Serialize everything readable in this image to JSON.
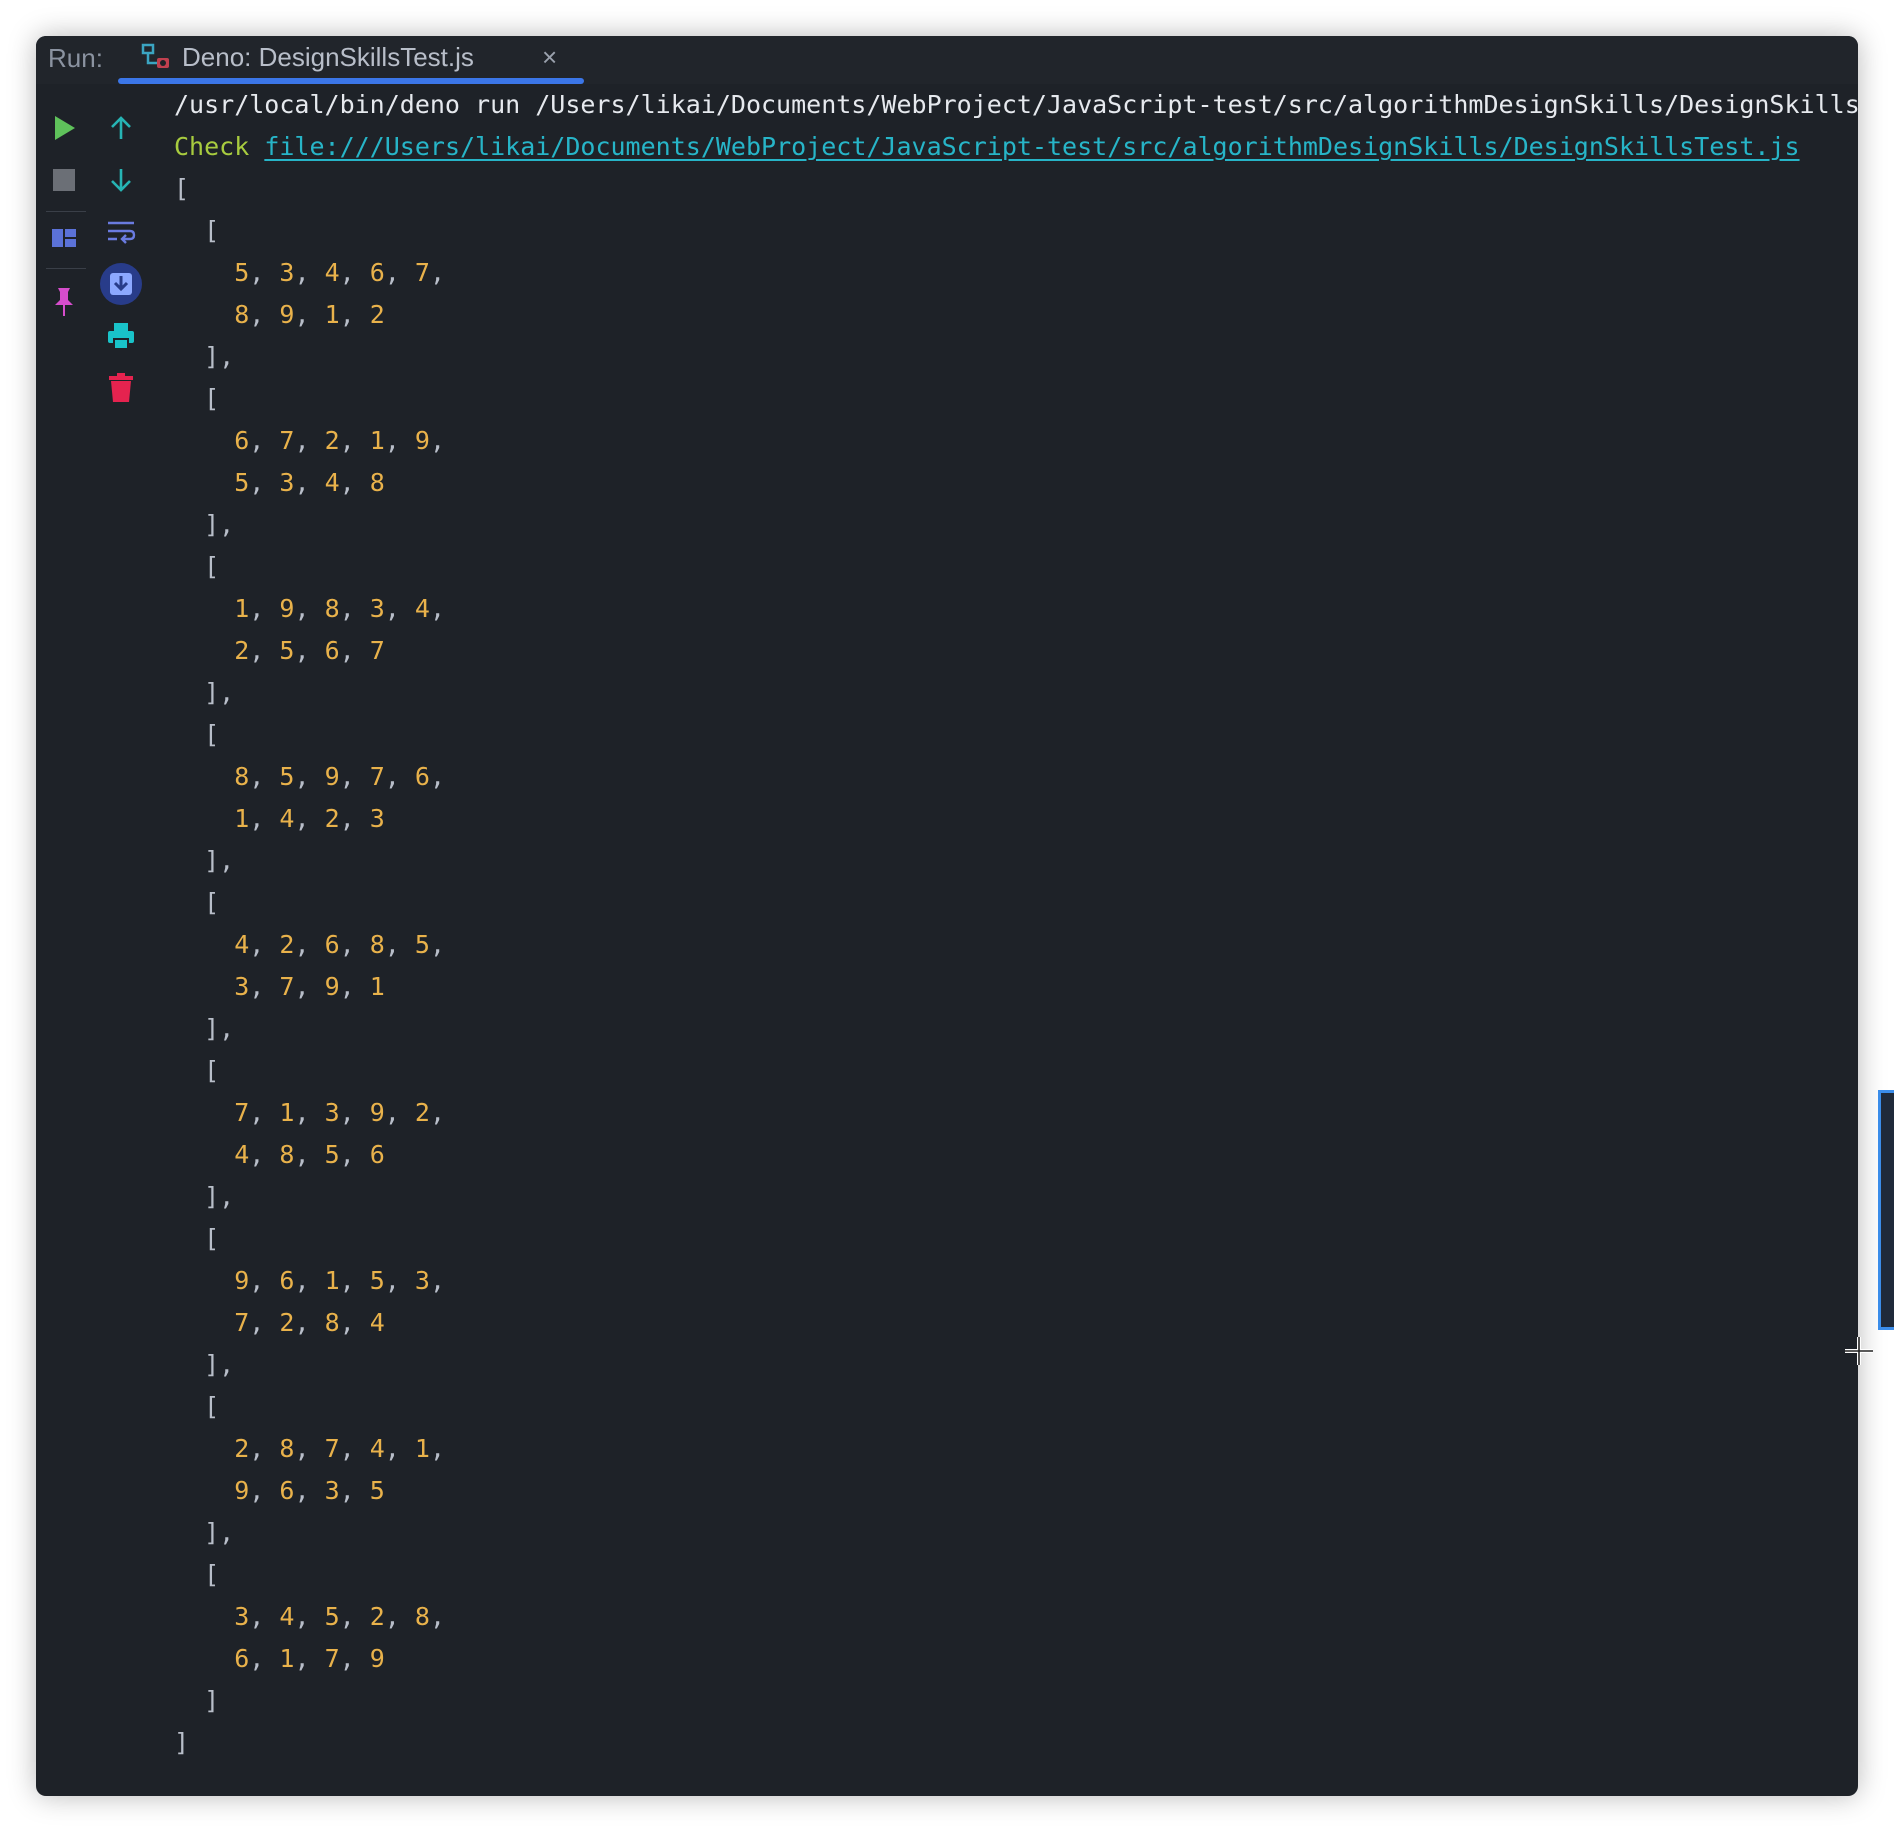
{
  "panel": {
    "run_label": "Run:",
    "tab_title": "Deno: DesignSkillsTest.js",
    "tab_close": "×"
  },
  "colors": {
    "background": "#1e2228",
    "accent": "#3b76e8",
    "run_green": "#5fc25b",
    "nav_teal": "#26b4b4",
    "print_teal": "#19c3c9",
    "trash_red": "#e5234f",
    "pin_pink": "#d64dcc",
    "check_green": "#a8cc3f",
    "link_cyan": "#27b5c8",
    "number_orange": "#e9b24b"
  },
  "toolbar": {
    "left": [
      "run-icon",
      "stop-icon",
      "layout-icon",
      "pin-icon"
    ],
    "right": [
      "up-arrow-icon",
      "down-arrow-icon",
      "soft-wrap-icon",
      "scroll-to-end-icon",
      "print-icon",
      "trash-icon"
    ]
  },
  "console": {
    "command": "/usr/local/bin/deno run /Users/likai/Documents/WebProject/JavaScript-test/src/algorithmDesignSkills/DesignSkillsTest.js",
    "check_word": "Check",
    "check_link": "file:///Users/likai/Documents/WebProject/JavaScript-test/src/algorithmDesignSkills/DesignSkillsTest.js",
    "open_outer": "[",
    "close_outer": "]",
    "arrays": [
      [
        5,
        3,
        4,
        6,
        7,
        8,
        9,
        1,
        2
      ],
      [
        6,
        7,
        2,
        1,
        9,
        5,
        3,
        4,
        8
      ],
      [
        1,
        9,
        8,
        3,
        4,
        2,
        5,
        6,
        7
      ],
      [
        8,
        5,
        9,
        7,
        6,
        1,
        4,
        2,
        3
      ],
      [
        4,
        2,
        6,
        8,
        5,
        3,
        7,
        9,
        1
      ],
      [
        7,
        1,
        3,
        9,
        2,
        4,
        8,
        5,
        6
      ],
      [
        9,
        6,
        1,
        5,
        3,
        7,
        2,
        8,
        4
      ],
      [
        2,
        8,
        7,
        4,
        1,
        9,
        6,
        3,
        5
      ],
      [
        3,
        4,
        5,
        2,
        8,
        6,
        1,
        7,
        9
      ]
    ]
  }
}
